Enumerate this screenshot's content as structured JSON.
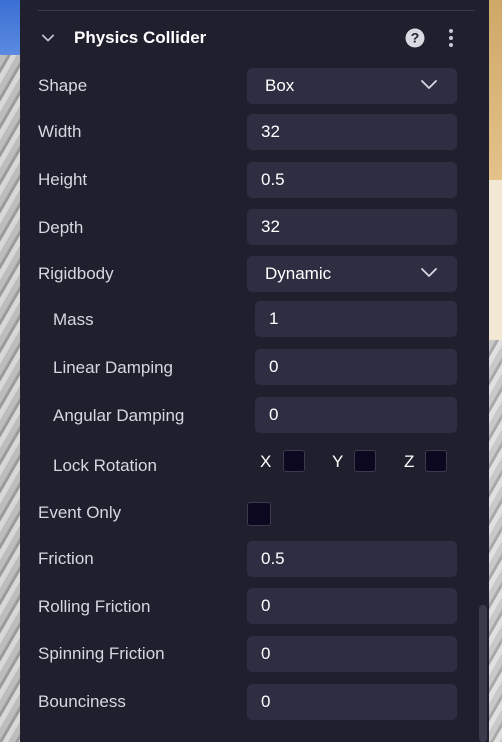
{
  "section": {
    "title": "Physics Collider"
  },
  "rows": {
    "shape": {
      "label": "Shape",
      "value": "Box"
    },
    "width": {
      "label": "Width",
      "value": "32"
    },
    "height": {
      "label": "Height",
      "value": "0.5"
    },
    "depth": {
      "label": "Depth",
      "value": "32"
    },
    "rigidbody": {
      "label": "Rigidbody",
      "value": "Dynamic"
    },
    "mass": {
      "label": "Mass",
      "value": "1"
    },
    "linear_damping": {
      "label": "Linear Damping",
      "value": "0"
    },
    "angular_damping": {
      "label": "Angular Damping",
      "value": "0"
    },
    "lock_rotation": {
      "label": "Lock Rotation",
      "x": "X",
      "y": "Y",
      "z": "Z"
    },
    "event_only": {
      "label": "Event Only"
    },
    "friction": {
      "label": "Friction",
      "value": "0.5"
    },
    "rolling_friction": {
      "label": "Rolling Friction",
      "value": "0"
    },
    "spinning_friction": {
      "label": "Spinning Friction",
      "value": "0"
    },
    "bounciness": {
      "label": "Bounciness",
      "value": "0"
    }
  },
  "colors": {
    "panel_bg": "#1f1f2e",
    "field_bg": "#2e2e42",
    "checkbox_bg": "#0b0820"
  },
  "icons": [
    "chevron-down-icon",
    "help-icon",
    "more-vertical-icon"
  ]
}
